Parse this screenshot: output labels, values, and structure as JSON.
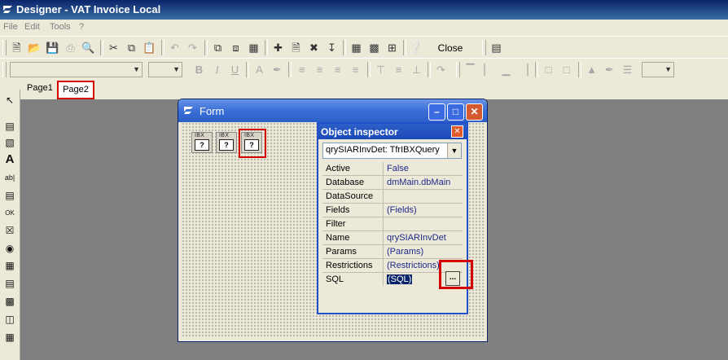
{
  "window": {
    "title": "Designer - VAT Invoice Local"
  },
  "menu": [
    "File",
    "Edit",
    "Tools",
    "?"
  ],
  "toolbar": {
    "close_label": "Close"
  },
  "tabs": {
    "page1": "Page1",
    "page2": "Page2"
  },
  "form": {
    "title": "Form",
    "components": [
      {
        "label": "IBX",
        "glyph": "?"
      },
      {
        "label": "IBX",
        "glyph": "?"
      },
      {
        "label": "IBX",
        "glyph": "?"
      }
    ]
  },
  "inspector": {
    "title": "Object inspector",
    "selected": "qrySIARInvDet: TfrIBXQuery",
    "properties": [
      {
        "name": "Active",
        "value": "False"
      },
      {
        "name": "Database",
        "value": "dmMain.dbMain"
      },
      {
        "name": "DataSource",
        "value": ""
      },
      {
        "name": "Fields",
        "value": "(Fields)"
      },
      {
        "name": "Filter",
        "value": ""
      },
      {
        "name": "Name",
        "value": "qrySIARInvDet"
      },
      {
        "name": "Params",
        "value": "(Params)"
      },
      {
        "name": "Restrictions",
        "value": "(Restrictions)"
      },
      {
        "name": "SQL",
        "value": "(SQL)"
      }
    ],
    "ellipsis": "..."
  },
  "colors": {
    "highlight": "#d40000",
    "titlebar": "#0a246a",
    "workspace": "#808080"
  }
}
